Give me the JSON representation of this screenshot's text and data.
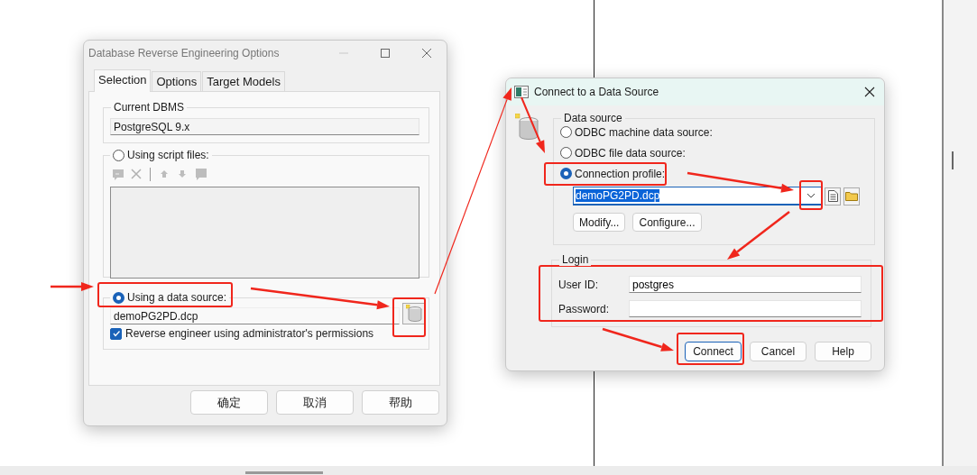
{
  "reverse_dialog": {
    "title": "Database Reverse Engineering Options",
    "tabs": [
      {
        "label": "Selection",
        "selected": true
      },
      {
        "label": "Options",
        "selected": false
      },
      {
        "label": "Target Models",
        "selected": false
      }
    ],
    "current_dbms": {
      "legend": "Current DBMS",
      "value": "PostgreSQL 9.x"
    },
    "script_files": {
      "label": "Using script files:",
      "selected": false,
      "toolbar": [
        {
          "kind": "add",
          "disabled": true
        },
        {
          "kind": "delete",
          "disabled": true
        },
        {
          "kind": "separator"
        },
        {
          "kind": "up",
          "disabled": true
        },
        {
          "kind": "down",
          "disabled": true
        },
        {
          "kind": "browse",
          "disabled": true
        }
      ]
    },
    "data_source": {
      "label": "Using a data source:",
      "selected": true,
      "value": "demoPG2PD.dcp"
    },
    "admin_permissions": {
      "label": "Reverse engineer using administrator's permissions",
      "checked": true
    },
    "buttons": [
      "确定",
      "取消",
      "帮助"
    ]
  },
  "connect_dialog": {
    "title": "Connect to a Data Source",
    "data_source": {
      "legend": "Data source",
      "options": [
        {
          "label": "ODBC machine data source:",
          "selected": false
        },
        {
          "label": "ODBC file data source:",
          "selected": false
        },
        {
          "label": "Connection profile:",
          "selected": true
        }
      ],
      "profile": {
        "value": "demoPG2PD.dcp",
        "highlighted": true
      },
      "buttons": [
        "Modify...",
        "Configure..."
      ]
    },
    "login": {
      "legend": "Login",
      "fields": [
        {
          "label": "User ID:",
          "value": "postgres"
        },
        {
          "label": "Password:"
        }
      ]
    },
    "buttons": [
      {
        "label": "Connect",
        "default": true
      },
      {
        "label": "Cancel",
        "default": false
      },
      {
        "label": "Help",
        "default": false
      }
    ]
  }
}
